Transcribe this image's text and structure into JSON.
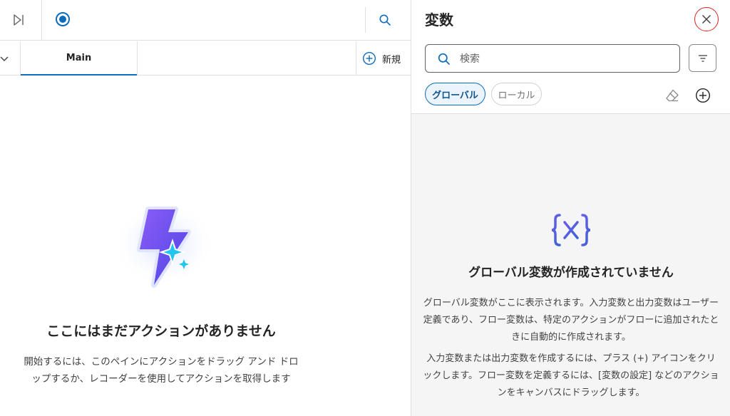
{
  "toolbar": {
    "step_icon": "step-forward-icon",
    "record_icon": "record-icon",
    "search_icon": "search-icon"
  },
  "tabs": {
    "collapse_icon": "chevron-down-icon",
    "items": [
      {
        "label": "Main",
        "selected": true
      }
    ],
    "new_label": "新規",
    "new_icon": "add-circle-icon"
  },
  "canvas_empty": {
    "illustration": "lightning-sparkle-icon",
    "title": "ここにはまだアクションがありません",
    "description": "開始するには、このペインにアクションをドラッグ アンド ドロップするか、レコーダーを使用してアクションを取得します"
  },
  "variables_panel": {
    "title": "変数",
    "close_icon": "close-icon",
    "search": {
      "placeholder": "検索",
      "value": "",
      "icon": "search-icon"
    },
    "filter_icon": "filter-icon",
    "scopes": [
      {
        "label": "グローバル",
        "selected": true
      },
      {
        "label": "ローカル",
        "selected": false
      }
    ],
    "clear_icon": "eraser-icon",
    "add_icon": "add-circle-icon",
    "empty": {
      "icon": "variable-icon",
      "title": "グローバル変数が作成されていません",
      "description_1": "グローバル変数がここに表示されます。入力変数と出力変数はユーザー定義であり、フロー変数は、特定のアクションがフローに追加されたときに自動的に作成されます。",
      "description_2": "入力変数または出力変数を作成するには、プラス (+) アイコンをクリックします。フロー変数を定義するには、[変数の設定] などのアクションをキャンバスにドラッグします。"
    }
  },
  "colors": {
    "accent": "#0f6cbd",
    "close_highlight": "#e02020",
    "panel_background": "#f5f5f5"
  }
}
